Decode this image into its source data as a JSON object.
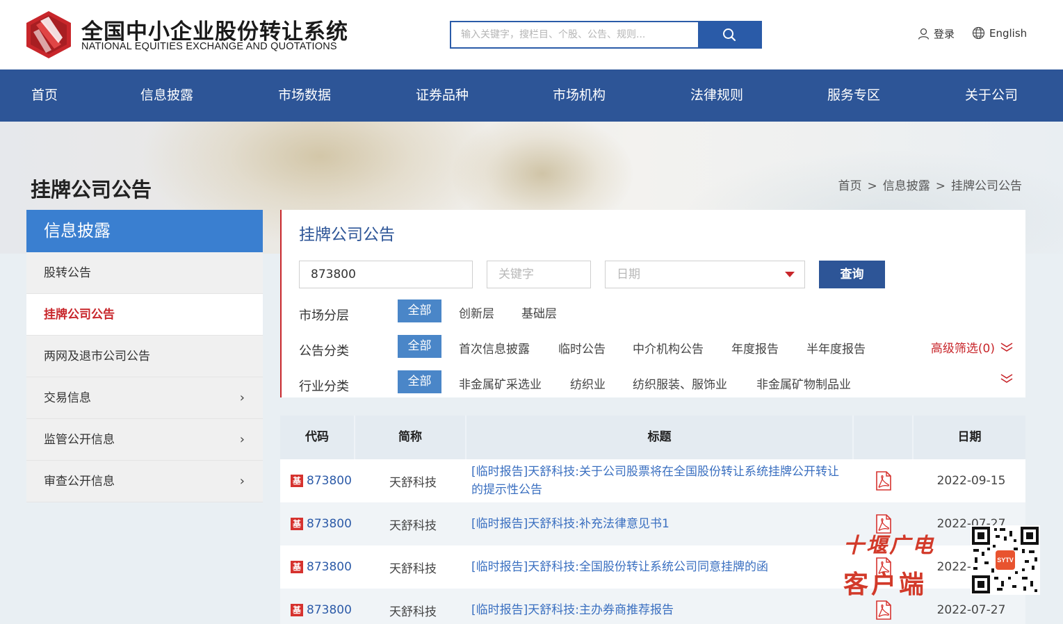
{
  "header": {
    "logo_cn": "全国中小企业股份转让系统",
    "logo_en": "NATIONAL EQUITIES EXCHANGE AND QUOTATIONS",
    "search_placeholder": "输入关键字，搜栏目、个股、公告、规则...",
    "login": "登录",
    "language": "English",
    "icons": [
      "search-icon",
      "user-icon",
      "globe-icon"
    ]
  },
  "nav": [
    "首页",
    "信息披露",
    "市场数据",
    "证券品种",
    "市场机构",
    "法律规则",
    "服务专区",
    "关于公司"
  ],
  "banner": {
    "page_title": "挂牌公司公告",
    "breadcrumb": [
      "首页",
      "信息披露",
      "挂牌公司公告"
    ],
    "sep": ">"
  },
  "sidebar": {
    "heading": "信息披露",
    "items": [
      {
        "label": "股转公告",
        "active": false,
        "has_arrow": false
      },
      {
        "label": "挂牌公司公告",
        "active": true,
        "has_arrow": false
      },
      {
        "label": "两网及退市公司公告",
        "active": false,
        "has_arrow": false
      },
      {
        "label": "交易信息",
        "active": false,
        "has_arrow": true
      },
      {
        "label": "监管公开信息",
        "active": false,
        "has_arrow": true
      },
      {
        "label": "审查公开信息",
        "active": false,
        "has_arrow": true
      }
    ],
    "arrow": "›"
  },
  "panel": {
    "title": "挂牌公司公告",
    "code_value": "873800",
    "keyword_placeholder": "关键字",
    "date_placeholder": "日期",
    "query_label": "查询",
    "filters": {
      "market": {
        "label": "市场分层",
        "all": "全部",
        "options": [
          "创新层",
          "基础层"
        ]
      },
      "category": {
        "label": "公告分类",
        "all": "全部",
        "options": [
          "首次信息披露",
          "临时公告",
          "中介机构公告",
          "年度报告",
          "半年度报告"
        ]
      },
      "industry": {
        "label": "行业分类",
        "all": "全部",
        "options": [
          "非金属矿采选业",
          "纺织业",
          "纺织服装、服饰业",
          "非金属矿物制品业"
        ]
      }
    },
    "advanced": "高级筛选(0)"
  },
  "table": {
    "headers": [
      "代码",
      "简称",
      "标题",
      "",
      "日期"
    ],
    "badge": "基",
    "rows": [
      {
        "code": "873800",
        "name": "天舒科技",
        "title": "[临时报告]天舒科技:关于公司股票将在全国股份转让系统挂牌公开转让的提示性公告",
        "date": "2022-09-15"
      },
      {
        "code": "873800",
        "name": "天舒科技",
        "title": "[临时报告]天舒科技:补充法律意见书1",
        "date": "2022-07-27"
      },
      {
        "code": "873800",
        "name": "天舒科技",
        "title": "[临时报告]天舒科技:全国股份转让系统公司同意挂牌的函",
        "date": "2022-07-27"
      },
      {
        "code": "873800",
        "name": "天舒科技",
        "title": "[临时报告]天舒科技:主办券商推荐报告",
        "date": "2022-07-27"
      }
    ]
  },
  "watermark": {
    "line1": "十堰广电",
    "line2": "客户端",
    "qr_label": "SYTV"
  },
  "colors": {
    "nav_bg": "#2d5597",
    "sidebar_head": "#3a7fd0",
    "active_red": "#c8262b",
    "chip_blue": "#4a86c8",
    "link_blue": "#3a6fc0"
  }
}
